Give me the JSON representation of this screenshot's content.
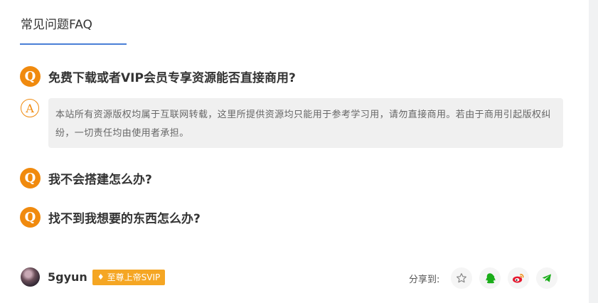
{
  "faq": {
    "title": "常见问题FAQ",
    "q_glyph": "Q",
    "a_glyph": "A",
    "questions": [
      {
        "text": "免费下载或者VIP会员专享资源能否直接商用?",
        "answer": "本站所有资源版权均属于互联网转载，这里所提供资源均只能用于参考学习用，请勿直接商用。若由于商用引起版权纠纷，一切责任均由使用者承担。"
      },
      {
        "text": "我不会搭建怎么办?"
      },
      {
        "text": "找不到我想要的东西怎么办?"
      }
    ]
  },
  "author": {
    "name": "5gyun",
    "badge": "至尊上帝SVIP"
  },
  "share": {
    "label": "分享到:",
    "buttons": [
      {
        "icon": "star-icon",
        "color": "#888888"
      },
      {
        "icon": "qq-icon",
        "color": "#1aad19"
      },
      {
        "icon": "weibo-icon",
        "color": "#e6162d"
      },
      {
        "icon": "telegram-icon",
        "color": "#1aad19"
      }
    ]
  },
  "colors": {
    "accent": "#f08a0e",
    "underline": "#4a7fd6",
    "badge": "#f5a623"
  }
}
